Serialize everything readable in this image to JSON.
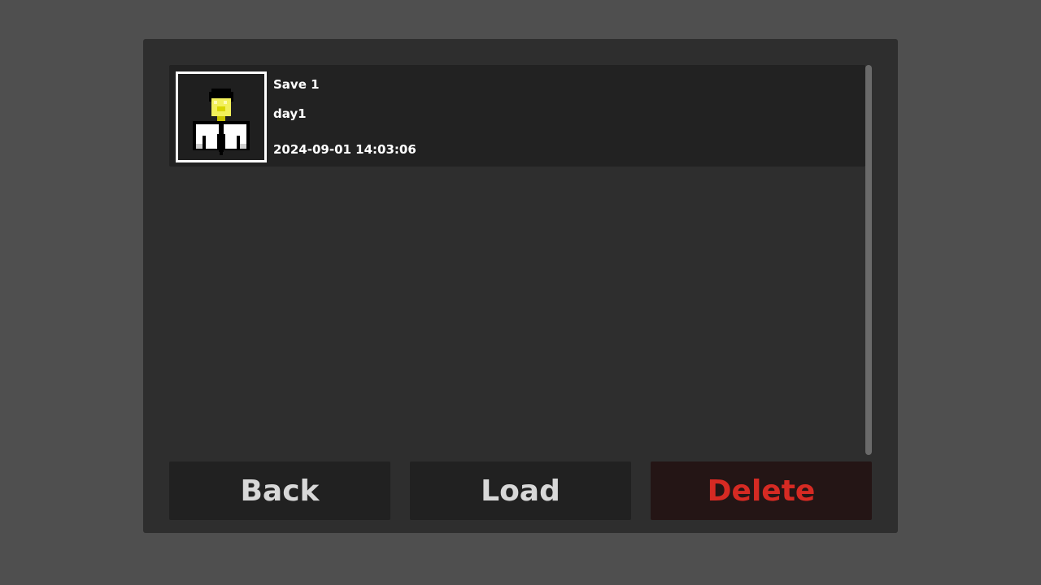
{
  "saves": [
    {
      "title": "Save 1",
      "label": "day1",
      "timestamp": "2024-09-01 14:03:06",
      "thumbnail_icon": "character-portrait-icon"
    }
  ],
  "buttons": {
    "back": "Back",
    "load": "Load",
    "delete": "Delete"
  },
  "colors": {
    "background": "#4f4f4f",
    "panel": "#2e2e2e",
    "row": "#222222",
    "button": "#212121",
    "delete_button": "#241515",
    "delete_text": "#d62a23",
    "text": "#ffffff"
  }
}
